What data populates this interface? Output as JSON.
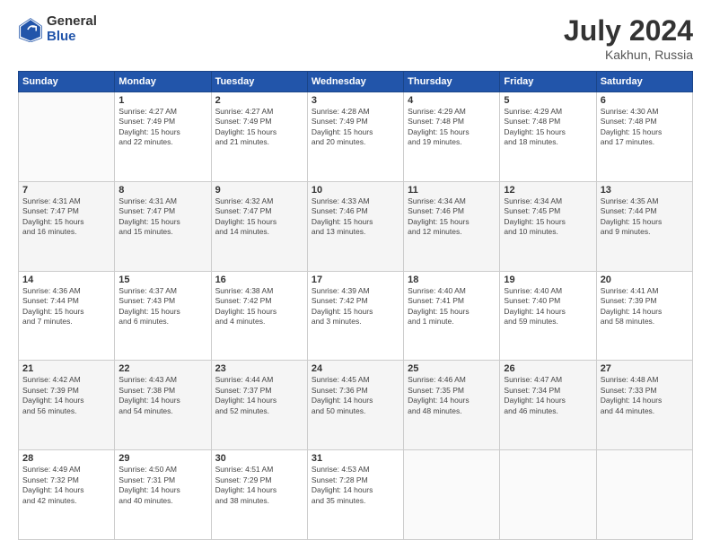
{
  "header": {
    "logo_general": "General",
    "logo_blue": "Blue",
    "title": "July 2024",
    "location": "Kakhun, Russia"
  },
  "weekdays": [
    "Sunday",
    "Monday",
    "Tuesday",
    "Wednesday",
    "Thursday",
    "Friday",
    "Saturday"
  ],
  "weeks": [
    [
      {
        "day": "",
        "info": ""
      },
      {
        "day": "1",
        "info": "Sunrise: 4:27 AM\nSunset: 7:49 PM\nDaylight: 15 hours\nand 22 minutes."
      },
      {
        "day": "2",
        "info": "Sunrise: 4:27 AM\nSunset: 7:49 PM\nDaylight: 15 hours\nand 21 minutes."
      },
      {
        "day": "3",
        "info": "Sunrise: 4:28 AM\nSunset: 7:49 PM\nDaylight: 15 hours\nand 20 minutes."
      },
      {
        "day": "4",
        "info": "Sunrise: 4:29 AM\nSunset: 7:48 PM\nDaylight: 15 hours\nand 19 minutes."
      },
      {
        "day": "5",
        "info": "Sunrise: 4:29 AM\nSunset: 7:48 PM\nDaylight: 15 hours\nand 18 minutes."
      },
      {
        "day": "6",
        "info": "Sunrise: 4:30 AM\nSunset: 7:48 PM\nDaylight: 15 hours\nand 17 minutes."
      }
    ],
    [
      {
        "day": "7",
        "info": "Sunrise: 4:31 AM\nSunset: 7:47 PM\nDaylight: 15 hours\nand 16 minutes."
      },
      {
        "day": "8",
        "info": "Sunrise: 4:31 AM\nSunset: 7:47 PM\nDaylight: 15 hours\nand 15 minutes."
      },
      {
        "day": "9",
        "info": "Sunrise: 4:32 AM\nSunset: 7:47 PM\nDaylight: 15 hours\nand 14 minutes."
      },
      {
        "day": "10",
        "info": "Sunrise: 4:33 AM\nSunset: 7:46 PM\nDaylight: 15 hours\nand 13 minutes."
      },
      {
        "day": "11",
        "info": "Sunrise: 4:34 AM\nSunset: 7:46 PM\nDaylight: 15 hours\nand 12 minutes."
      },
      {
        "day": "12",
        "info": "Sunrise: 4:34 AM\nSunset: 7:45 PM\nDaylight: 15 hours\nand 10 minutes."
      },
      {
        "day": "13",
        "info": "Sunrise: 4:35 AM\nSunset: 7:44 PM\nDaylight: 15 hours\nand 9 minutes."
      }
    ],
    [
      {
        "day": "14",
        "info": "Sunrise: 4:36 AM\nSunset: 7:44 PM\nDaylight: 15 hours\nand 7 minutes."
      },
      {
        "day": "15",
        "info": "Sunrise: 4:37 AM\nSunset: 7:43 PM\nDaylight: 15 hours\nand 6 minutes."
      },
      {
        "day": "16",
        "info": "Sunrise: 4:38 AM\nSunset: 7:42 PM\nDaylight: 15 hours\nand 4 minutes."
      },
      {
        "day": "17",
        "info": "Sunrise: 4:39 AM\nSunset: 7:42 PM\nDaylight: 15 hours\nand 3 minutes."
      },
      {
        "day": "18",
        "info": "Sunrise: 4:40 AM\nSunset: 7:41 PM\nDaylight: 15 hours\nand 1 minute."
      },
      {
        "day": "19",
        "info": "Sunrise: 4:40 AM\nSunset: 7:40 PM\nDaylight: 14 hours\nand 59 minutes."
      },
      {
        "day": "20",
        "info": "Sunrise: 4:41 AM\nSunset: 7:39 PM\nDaylight: 14 hours\nand 58 minutes."
      }
    ],
    [
      {
        "day": "21",
        "info": "Sunrise: 4:42 AM\nSunset: 7:39 PM\nDaylight: 14 hours\nand 56 minutes."
      },
      {
        "day": "22",
        "info": "Sunrise: 4:43 AM\nSunset: 7:38 PM\nDaylight: 14 hours\nand 54 minutes."
      },
      {
        "day": "23",
        "info": "Sunrise: 4:44 AM\nSunset: 7:37 PM\nDaylight: 14 hours\nand 52 minutes."
      },
      {
        "day": "24",
        "info": "Sunrise: 4:45 AM\nSunset: 7:36 PM\nDaylight: 14 hours\nand 50 minutes."
      },
      {
        "day": "25",
        "info": "Sunrise: 4:46 AM\nSunset: 7:35 PM\nDaylight: 14 hours\nand 48 minutes."
      },
      {
        "day": "26",
        "info": "Sunrise: 4:47 AM\nSunset: 7:34 PM\nDaylight: 14 hours\nand 46 minutes."
      },
      {
        "day": "27",
        "info": "Sunrise: 4:48 AM\nSunset: 7:33 PM\nDaylight: 14 hours\nand 44 minutes."
      }
    ],
    [
      {
        "day": "28",
        "info": "Sunrise: 4:49 AM\nSunset: 7:32 PM\nDaylight: 14 hours\nand 42 minutes."
      },
      {
        "day": "29",
        "info": "Sunrise: 4:50 AM\nSunset: 7:31 PM\nDaylight: 14 hours\nand 40 minutes."
      },
      {
        "day": "30",
        "info": "Sunrise: 4:51 AM\nSunset: 7:29 PM\nDaylight: 14 hours\nand 38 minutes."
      },
      {
        "day": "31",
        "info": "Sunrise: 4:53 AM\nSunset: 7:28 PM\nDaylight: 14 hours\nand 35 minutes."
      },
      {
        "day": "",
        "info": ""
      },
      {
        "day": "",
        "info": ""
      },
      {
        "day": "",
        "info": ""
      }
    ]
  ]
}
